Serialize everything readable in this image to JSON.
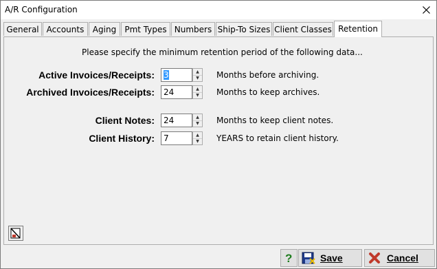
{
  "window": {
    "title": "A/R Configuration"
  },
  "tabs": [
    {
      "label": "General"
    },
    {
      "label": "Accounts"
    },
    {
      "label": "Aging"
    },
    {
      "label": "Pmt Types"
    },
    {
      "label": "Numbers"
    },
    {
      "label": "Ship-To Sizes"
    },
    {
      "label": "Client Classes"
    },
    {
      "label": "Retention"
    }
  ],
  "active_tab": "Retention",
  "retention": {
    "intro": "Please specify the minimum retention period of the following data...",
    "fields": [
      {
        "label": "Active Invoices/Receipts:",
        "value": "3",
        "hint": "Months before archiving."
      },
      {
        "label": "Archived Invoices/Receipts:",
        "value": "24",
        "hint": "Months to keep archives."
      },
      {
        "label": "Client Notes:",
        "value": "24",
        "hint": "Months to keep client notes."
      },
      {
        "label": "Client History:",
        "value": "7",
        "hint": "YEARS to retain client history."
      }
    ]
  },
  "buttons": {
    "save_label": "Save",
    "cancel_label": "Cancel"
  },
  "icons": {
    "close": "close-icon",
    "print": "print-icon",
    "help": "help-icon",
    "save": "floppy-disk-icon",
    "cancel": "red-x-icon"
  },
  "colors": {
    "selection": "#3399ff",
    "cancel_x": "#c0392b",
    "help_q": "#1e7d1e"
  }
}
